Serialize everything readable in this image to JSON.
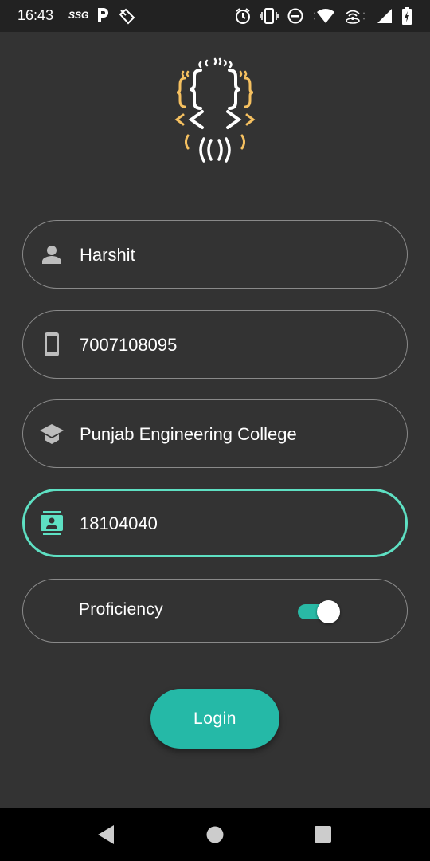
{
  "status_bar": {
    "time": "16:43",
    "carrier_badge": "SSG",
    "left_icons": [
      "p-app-icon",
      "clean-icon"
    ],
    "right_icons": [
      "alarm-icon",
      "vibrate-icon",
      "dnd-icon",
      "wifi-icon",
      "hotspot-icon",
      "signal-icon",
      "battery-icon"
    ]
  },
  "logo": {
    "icon": "code-brackets-logo",
    "colors": {
      "primary": "#ffffff",
      "accent": "#f5c060"
    }
  },
  "form": {
    "name": {
      "value": "Harshit",
      "icon": "person-icon"
    },
    "phone": {
      "value": "7007108095",
      "icon": "phone-icon"
    },
    "college": {
      "value": "Punjab Engineering College",
      "icon": "graduation-cap-icon"
    },
    "roll": {
      "value": "18104040",
      "icon": "contact-card-icon",
      "focused": true
    },
    "proficiency": {
      "label": "Proficiency",
      "enabled": true
    }
  },
  "login_button": {
    "label": "Login"
  },
  "colors": {
    "background": "#333333",
    "accent": "#25b9a7",
    "focus_border": "#5ee0c3",
    "field_border": "#8a8a8a"
  },
  "nav_bar": {
    "icons": [
      "back-icon",
      "home-icon",
      "recents-icon"
    ]
  }
}
